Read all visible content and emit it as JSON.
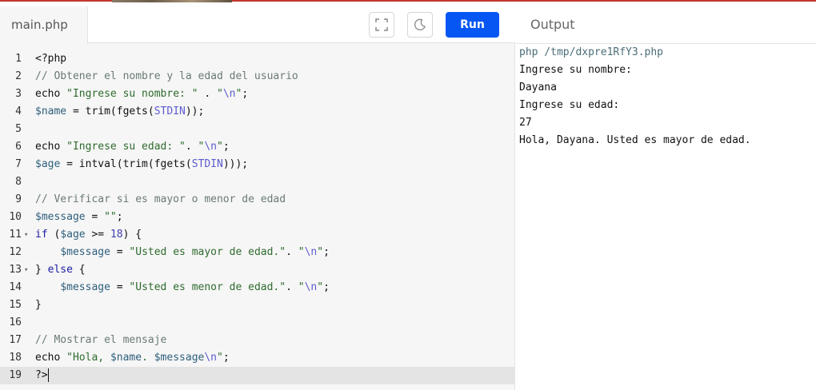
{
  "editor": {
    "file_tab": "main.php",
    "run_label": "Run",
    "fullscreen_icon": "fullscreen-icon",
    "theme_icon": "moon-icon",
    "active_line": 19,
    "lines": [
      {
        "n": "1",
        "fold": "",
        "tokens": [
          {
            "t": "plain",
            "v": "<?php"
          }
        ]
      },
      {
        "n": "2",
        "fold": "",
        "tokens": [
          {
            "t": "cm",
            "v": "// Obtener el nombre y la edad del usuario"
          }
        ]
      },
      {
        "n": "3",
        "fold": "",
        "tokens": [
          {
            "t": "plain",
            "v": "echo "
          },
          {
            "t": "st",
            "v": "\"Ingrese su nombre: \""
          },
          {
            "t": "plain",
            "v": " . "
          },
          {
            "t": "st",
            "v": "\""
          },
          {
            "t": "esc",
            "v": "\\n"
          },
          {
            "t": "st",
            "v": "\""
          },
          {
            "t": "plain",
            "v": ";"
          }
        ]
      },
      {
        "n": "4",
        "fold": "",
        "tokens": [
          {
            "t": "var",
            "v": "$name"
          },
          {
            "t": "plain",
            "v": " = trim(fgets("
          },
          {
            "t": "esc",
            "v": "STDIN"
          },
          {
            "t": "plain",
            "v": "));"
          }
        ]
      },
      {
        "n": "5",
        "fold": "",
        "tokens": []
      },
      {
        "n": "6",
        "fold": "",
        "tokens": [
          {
            "t": "plain",
            "v": "echo "
          },
          {
            "t": "st",
            "v": "\"Ingrese su edad: \""
          },
          {
            "t": "plain",
            "v": ". "
          },
          {
            "t": "st",
            "v": "\""
          },
          {
            "t": "esc",
            "v": "\\n"
          },
          {
            "t": "st",
            "v": "\""
          },
          {
            "t": "plain",
            "v": ";"
          }
        ]
      },
      {
        "n": "7",
        "fold": "",
        "tokens": [
          {
            "t": "var",
            "v": "$age"
          },
          {
            "t": "plain",
            "v": " = intval(trim(fgets("
          },
          {
            "t": "esc",
            "v": "STDIN"
          },
          {
            "t": "plain",
            "v": ")));"
          }
        ]
      },
      {
        "n": "8",
        "fold": "",
        "tokens": []
      },
      {
        "n": "9",
        "fold": "",
        "tokens": [
          {
            "t": "cm",
            "v": "// Verificar si es mayor o menor de edad"
          }
        ]
      },
      {
        "n": "10",
        "fold": "",
        "tokens": [
          {
            "t": "var",
            "v": "$message"
          },
          {
            "t": "plain",
            "v": " = "
          },
          {
            "t": "st",
            "v": "\"\""
          },
          {
            "t": "plain",
            "v": ";"
          }
        ]
      },
      {
        "n": "11",
        "fold": "▾",
        "tokens": [
          {
            "t": "kw",
            "v": "if"
          },
          {
            "t": "plain",
            "v": " ("
          },
          {
            "t": "var",
            "v": "$age"
          },
          {
            "t": "plain",
            "v": " >= "
          },
          {
            "t": "num",
            "v": "18"
          },
          {
            "t": "plain",
            "v": ") {"
          }
        ]
      },
      {
        "n": "12",
        "fold": "",
        "tokens": [
          {
            "t": "plain",
            "v": "    "
          },
          {
            "t": "var",
            "v": "$message"
          },
          {
            "t": "plain",
            "v": " = "
          },
          {
            "t": "st",
            "v": "\"Usted es mayor de edad.\""
          },
          {
            "t": "plain",
            "v": ". "
          },
          {
            "t": "st",
            "v": "\""
          },
          {
            "t": "esc",
            "v": "\\n"
          },
          {
            "t": "st",
            "v": "\""
          },
          {
            "t": "plain",
            "v": ";"
          }
        ]
      },
      {
        "n": "13",
        "fold": "▾",
        "tokens": [
          {
            "t": "plain",
            "v": "} "
          },
          {
            "t": "kw",
            "v": "else"
          },
          {
            "t": "plain",
            "v": " {"
          }
        ]
      },
      {
        "n": "14",
        "fold": "",
        "tokens": [
          {
            "t": "plain",
            "v": "    "
          },
          {
            "t": "var",
            "v": "$message"
          },
          {
            "t": "plain",
            "v": " = "
          },
          {
            "t": "st",
            "v": "\"Usted es menor de edad.\""
          },
          {
            "t": "plain",
            "v": ". "
          },
          {
            "t": "st",
            "v": "\""
          },
          {
            "t": "esc",
            "v": "\\n"
          },
          {
            "t": "st",
            "v": "\""
          },
          {
            "t": "plain",
            "v": ";"
          }
        ]
      },
      {
        "n": "15",
        "fold": "",
        "tokens": [
          {
            "t": "plain",
            "v": "}"
          }
        ]
      },
      {
        "n": "16",
        "fold": "",
        "tokens": []
      },
      {
        "n": "17",
        "fold": "",
        "tokens": [
          {
            "t": "cm",
            "v": "// Mostrar el mensaje"
          }
        ]
      },
      {
        "n": "18",
        "fold": "",
        "tokens": [
          {
            "t": "plain",
            "v": "echo "
          },
          {
            "t": "st",
            "v": "\"Hola, "
          },
          {
            "t": "var",
            "v": "$name"
          },
          {
            "t": "st",
            "v": ". "
          },
          {
            "t": "var",
            "v": "$message"
          },
          {
            "t": "esc",
            "v": "\\n"
          },
          {
            "t": "st",
            "v": "\""
          },
          {
            "t": "plain",
            "v": ";"
          }
        ]
      },
      {
        "n": "19",
        "fold": "",
        "tokens": [
          {
            "t": "plain",
            "v": "?>"
          }
        ]
      }
    ]
  },
  "output": {
    "title": "Output",
    "command": "php /tmp/dxpre1RfY3.php",
    "lines": [
      "Ingrese su nombre:",
      "Dayana",
      "Ingrese su edad:",
      "27",
      "Hola, Dayana. Usted es mayor de edad."
    ]
  },
  "colors": {
    "run_button": "#0556f3",
    "editor_bg": "#f6f6f6",
    "active_line_bg": "#e4e4e4"
  }
}
